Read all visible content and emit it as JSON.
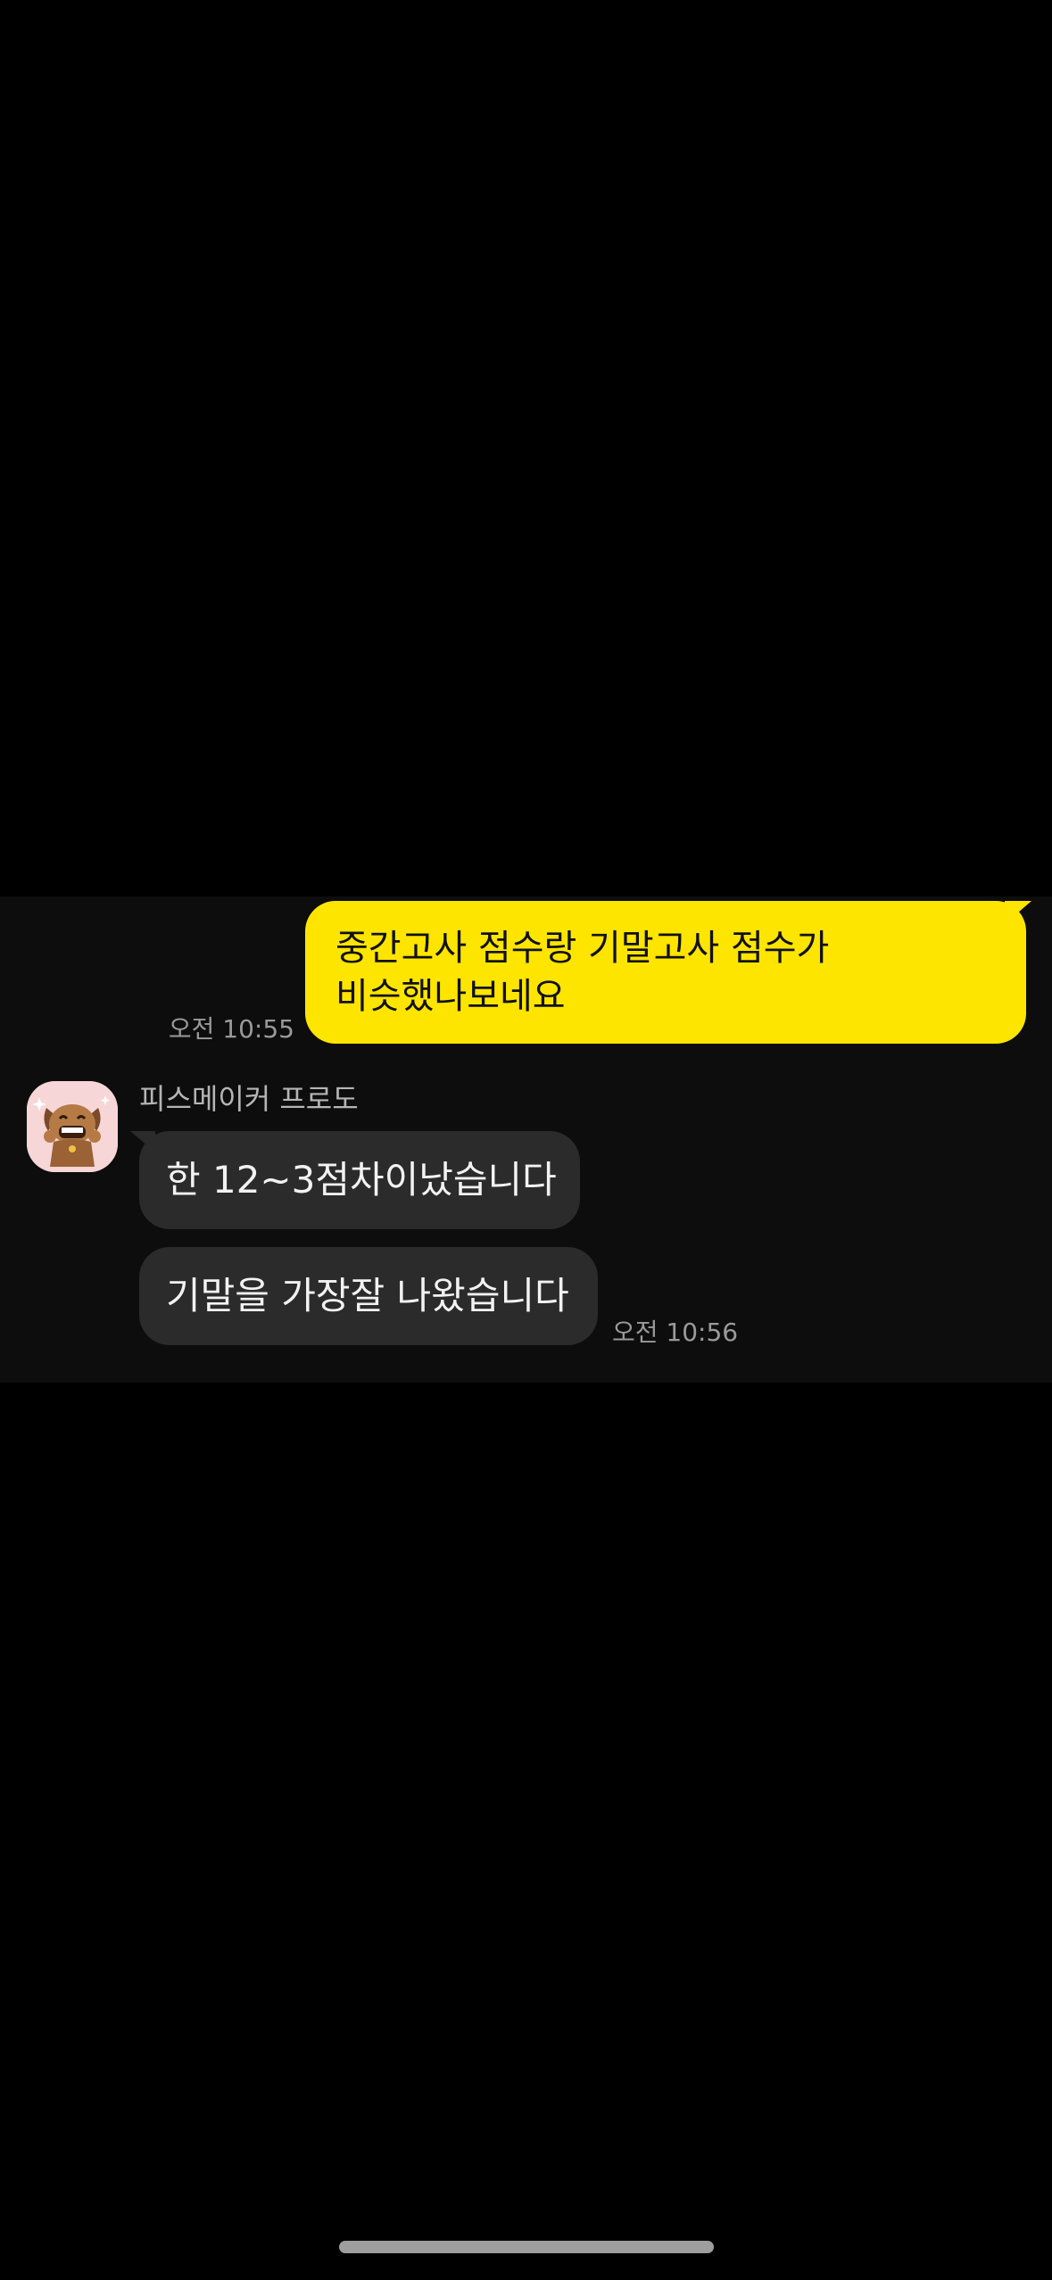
{
  "messages": {
    "outgoing": {
      "text": "중간고사 점수랑 기말고사 점수가 비슷했나보네요",
      "time": "오전 10:55"
    },
    "incoming": {
      "sender_name": "피스메이커 프로도",
      "avatar_icon": "dog-character-avatar-icon",
      "bubbles": [
        {
          "text": "한 12~3점차이났습니다"
        },
        {
          "text": "기말을 가장잘 나왔습니다"
        }
      ],
      "time": "오전 10:56"
    }
  },
  "colors": {
    "background": "#000000",
    "chat_panel": "#0d0d0d",
    "outgoing_bubble": "#fee500",
    "incoming_bubble": "#2b2b2b",
    "timestamp": "#9a9a9a"
  }
}
